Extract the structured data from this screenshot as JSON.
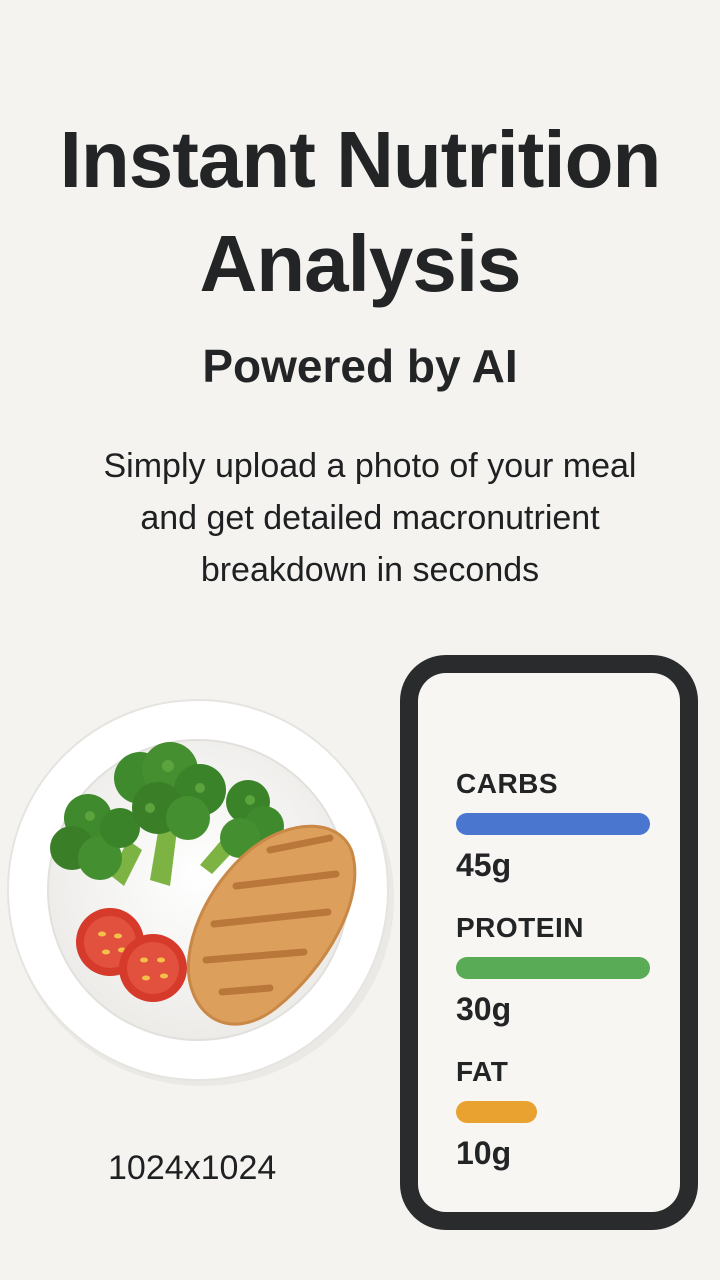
{
  "hero": {
    "title_line1": "Instant Nutrition",
    "title_line2": "Analysis",
    "subtitle": "Powered by AI",
    "description_lines": [
      "Simply upload a photo of your meal",
      "and get detailed macronutrient",
      "breakdown in seconds"
    ]
  },
  "illustration": {
    "size_label": "1024x1024"
  },
  "phone": {
    "macros": [
      {
        "name": "CARBS",
        "value": "45g",
        "bar_color": "#4a76d0",
        "bar_fraction": 1.0
      },
      {
        "name": "PROTEIN",
        "value": "30g",
        "bar_color": "#5aab55",
        "bar_fraction": 1.0
      },
      {
        "name": "FAT",
        "value": "10g",
        "bar_color": "#e9a230",
        "bar_fraction": 0.42
      }
    ]
  }
}
